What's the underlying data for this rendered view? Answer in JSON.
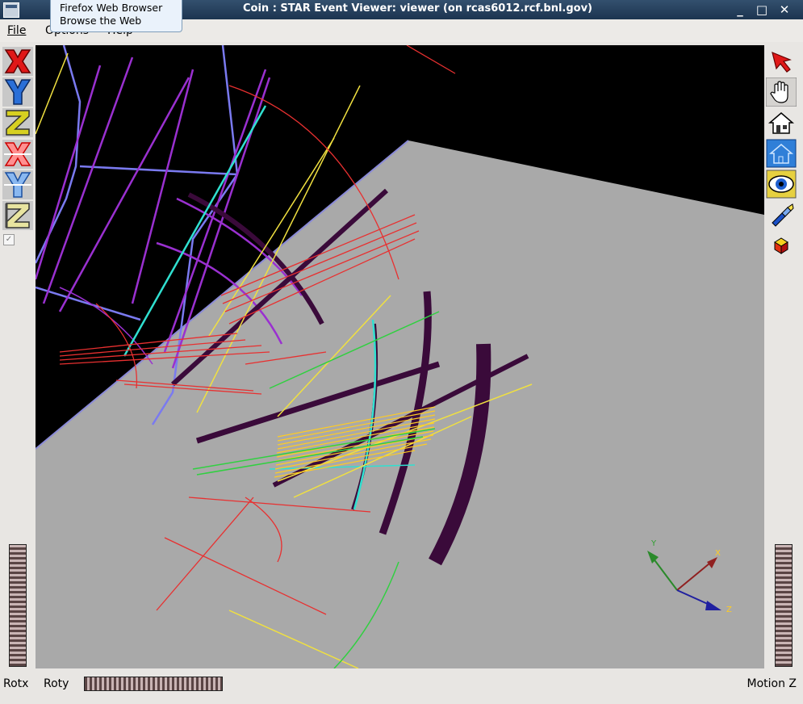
{
  "window": {
    "title": "Coin : STAR Event Viewer: viewer (on rcas6012.rcf.bnl.gov)",
    "minimize": "_",
    "maximize": "□",
    "close": "✕"
  },
  "tooltip": {
    "line1": "Firefox Web Browser",
    "line2": "Browse the Web"
  },
  "menu": {
    "file": "File",
    "options": "Options",
    "help": "Help"
  },
  "bottom": {
    "rotx": "Rotx",
    "roty": "Roty",
    "motion_z": "Motion Z"
  },
  "axes": {
    "x": "X",
    "y": "Y",
    "z": "Z"
  },
  "colors": {
    "background": "#000000",
    "plane": "#a9a9a9",
    "dark_tracks": "#3a0a3a",
    "hits": "#ffcc22"
  },
  "left_toolbar": [
    "x-view-icon",
    "y-view-icon",
    "z-view-icon",
    "x-flip-view-icon",
    "y-flip-view-icon",
    "z-flip-view-icon"
  ],
  "right_toolbar": [
    "pick-arrow-icon",
    "hand-view-icon",
    "home-icon",
    "set-home-icon",
    "view-all-icon",
    "seek-flashlight-icon",
    "projection-cube-icon"
  ]
}
